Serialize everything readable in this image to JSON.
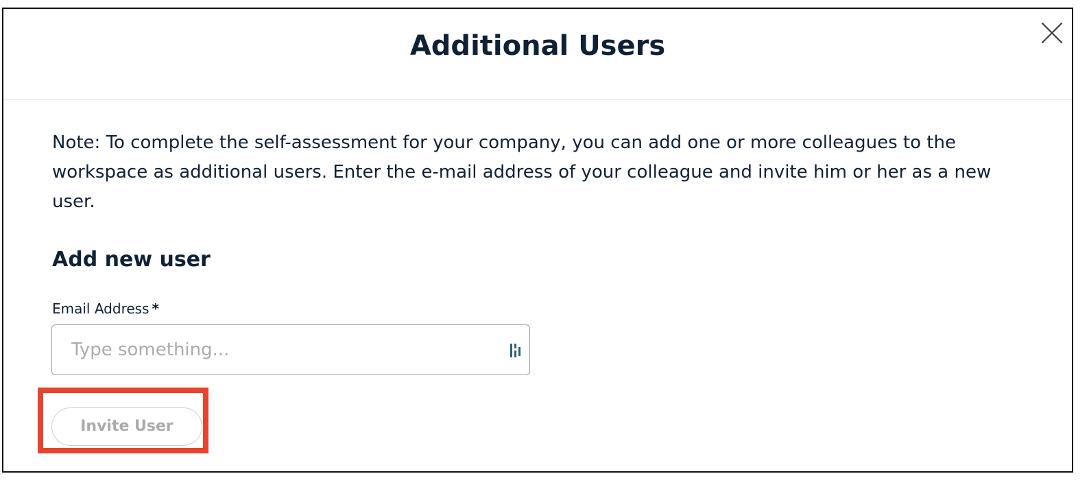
{
  "modal": {
    "title": "Additional Users",
    "close_icon": "close-icon",
    "note": "Note: To complete the self-assessment for your company, you can add one or more colleagues to the workspace as additional users. Enter the e-mail address of your colleague and invite him or her as a new user.",
    "section_heading": "Add new user"
  },
  "form": {
    "email_label": "Email Address",
    "required_mark": "*",
    "email_placeholder": "Type something...",
    "email_value": "",
    "input_extension_icon": "password-manager-icon",
    "invite_button_label": "Invite User",
    "invite_button_state": "disabled"
  },
  "colors": {
    "text_primary": "#0f2137",
    "placeholder": "#ababab",
    "highlight": "#e8432c",
    "extension_icon": "#2b6173"
  }
}
